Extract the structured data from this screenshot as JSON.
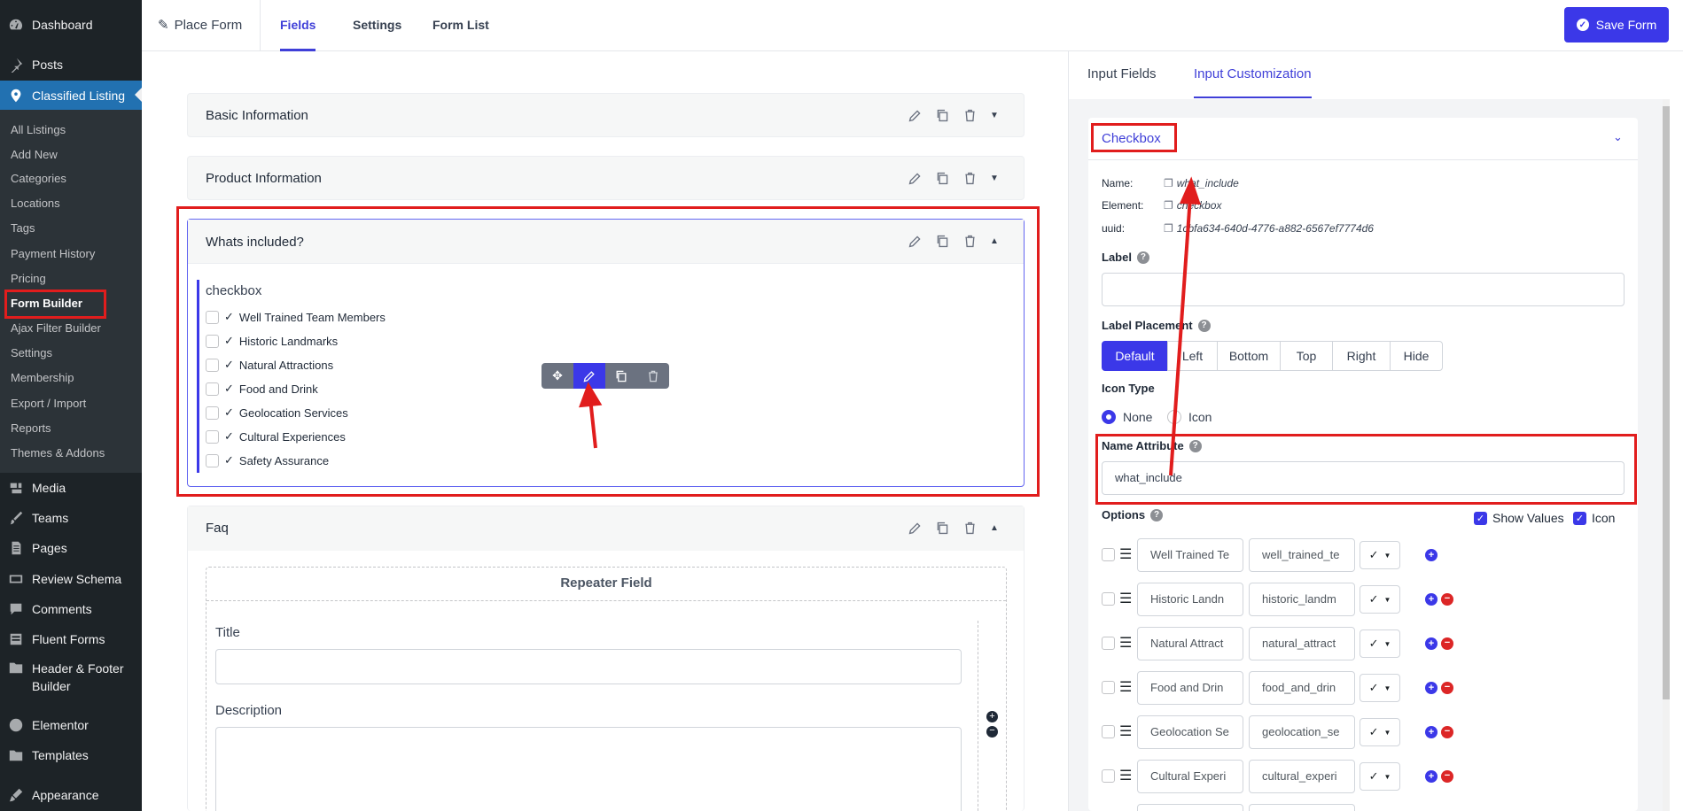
{
  "sidebar": {
    "items": [
      {
        "label": "Dashboard",
        "icon": "dashboard-icon"
      },
      {
        "label": "Posts",
        "icon": "pin-icon"
      },
      {
        "label": "Classified Listing",
        "icon": "location-pin-icon"
      }
    ],
    "submenu": [
      "All Listings",
      "Add New",
      "Categories",
      "Locations",
      "Tags",
      "Payment History",
      "Pricing",
      "Form Builder",
      "Ajax Filter Builder",
      "Settings",
      "Membership",
      "Export / Import",
      "Reports",
      "Themes & Addons"
    ],
    "bottom": [
      {
        "label": "Media",
        "icon": "media-icon"
      },
      {
        "label": "Teams",
        "icon": "brush-icon"
      },
      {
        "label": "Pages",
        "icon": "page-icon"
      },
      {
        "label": "Review Schema",
        "icon": "schema-icon"
      },
      {
        "label": "Comments",
        "icon": "comment-icon"
      },
      {
        "label": "Fluent Forms",
        "icon": "forms-icon"
      },
      {
        "label": "Header & Footer",
        "label2": "Builder",
        "icon": "folder-icon"
      },
      {
        "label": "Elementor",
        "icon": "elementor-icon"
      },
      {
        "label": "Templates",
        "icon": "folder-icon"
      },
      {
        "label": "Appearance",
        "icon": "paint-icon"
      }
    ]
  },
  "header": {
    "form_name": "Place Form",
    "tabs": [
      "Fields",
      "Settings",
      "Form List"
    ],
    "save_label": "Save Form"
  },
  "canvas": {
    "sections": [
      "Basic Information",
      "Product Information",
      "Whats included?",
      "Faq"
    ],
    "field_type": "checkbox",
    "options": [
      "Well Trained Team Members",
      "Historic Landmarks",
      "Natural Attractions",
      "Food and Drink",
      "Geolocation Services",
      "Cultural Experiences",
      "Safety Assurance"
    ],
    "repeater": {
      "title": "Repeater Field",
      "title_label": "Title",
      "description_label": "Description"
    }
  },
  "panel": {
    "tabs": [
      "Input Fields",
      "Input Customization"
    ],
    "field_title": "Checkbox",
    "meta": {
      "name_label": "Name:",
      "name_value": "what_include",
      "element_label": "Element:",
      "element_value": "checkbox",
      "uuid_label": "uuid:",
      "uuid_value": "1cbfa634-640d-4776-a882-6567ef7774d6"
    },
    "label_title": "Label",
    "label_placement_title": "Label Placement",
    "placements": [
      "Default",
      "Left",
      "Bottom",
      "Top",
      "Right",
      "Hide"
    ],
    "icon_type_title": "Icon Type",
    "icon_types": [
      "None",
      "Icon"
    ],
    "name_attribute_title": "Name Attribute",
    "name_attribute_value": "what_include",
    "options_title": "Options",
    "show_values_label": "Show Values",
    "icon_label": "Icon",
    "option_rows": [
      {
        "label": "Well Trained Te",
        "value": "well_trained_te"
      },
      {
        "label": "Historic Landn",
        "value": "historic_landm"
      },
      {
        "label": "Natural Attract",
        "value": "natural_attract"
      },
      {
        "label": "Food and Drin",
        "value": "food_and_drin"
      },
      {
        "label": "Geolocation Se",
        "value": "geolocation_se"
      },
      {
        "label": "Cultural Experi",
        "value": "cultural_experi"
      }
    ],
    "check_glyph": "✓"
  },
  "colors": {
    "accent": "#3b38e8",
    "highlight": "#e11d1d",
    "sidebar": "#1d2327",
    "wp_blue": "#2271b1"
  }
}
